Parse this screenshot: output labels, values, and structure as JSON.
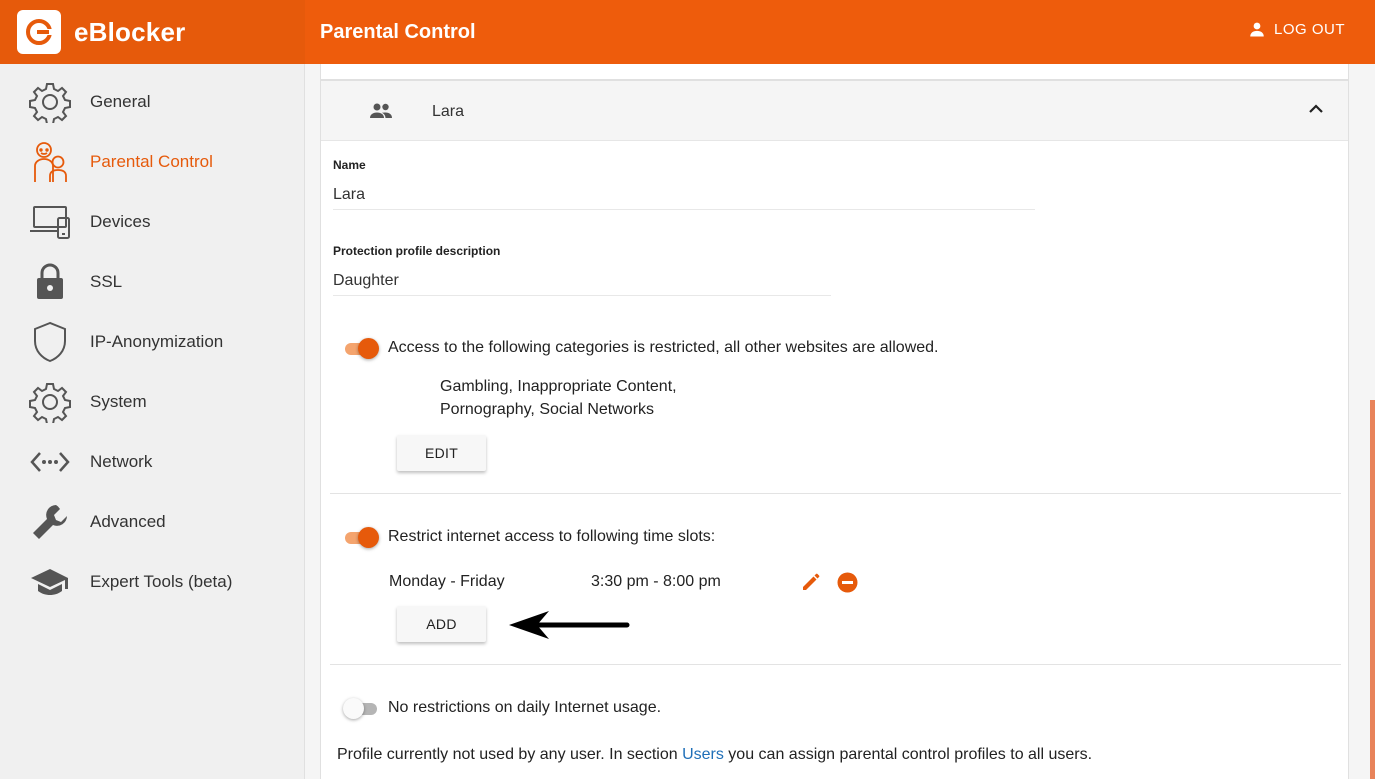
{
  "brand": {
    "name": "eBlocker"
  },
  "header": {
    "title": "Parental Control",
    "logout_label": "LOG OUT"
  },
  "sidebar": {
    "items": [
      {
        "label": "General",
        "icon": "gear-icon"
      },
      {
        "label": "Parental Control",
        "icon": "family-icon",
        "active": true
      },
      {
        "label": "Devices",
        "icon": "devices-icon"
      },
      {
        "label": "SSL",
        "icon": "lock-icon"
      },
      {
        "label": "IP-Anonymization",
        "icon": "shield-icon"
      },
      {
        "label": "System",
        "icon": "gear-icon"
      },
      {
        "label": "Network",
        "icon": "network-icon"
      },
      {
        "label": "Advanced",
        "icon": "wrench-icon"
      },
      {
        "label": "Expert Tools (beta)",
        "icon": "graduation-cap-icon"
      }
    ]
  },
  "profile": {
    "header_name": "Lara",
    "name_label": "Name",
    "name_value": "Lara",
    "description_label": "Protection profile description",
    "description_value": "Daughter",
    "categories": {
      "enabled": true,
      "text": "Access to the following categories is restricted, all other websites are allowed.",
      "line1": "Gambling,  Inappropriate Content,",
      "line2": "Pornography,  Social Networks",
      "edit_label": "EDIT"
    },
    "time_slots": {
      "enabled": true,
      "text": "Restrict internet access to following time slots:",
      "slots": [
        {
          "days": "Monday - Friday",
          "time": "3:30 pm - 8:00 pm"
        }
      ],
      "add_label": "ADD"
    },
    "daily_usage": {
      "enabled": false,
      "text": "No restrictions on daily Internet usage."
    },
    "footer": {
      "before": "Profile currently not used by any user. In section ",
      "link": "Users",
      "after": " you can assign parental control profiles to all users."
    }
  },
  "colors": {
    "accent": "#e65a0b",
    "link": "#1f6fb8"
  }
}
